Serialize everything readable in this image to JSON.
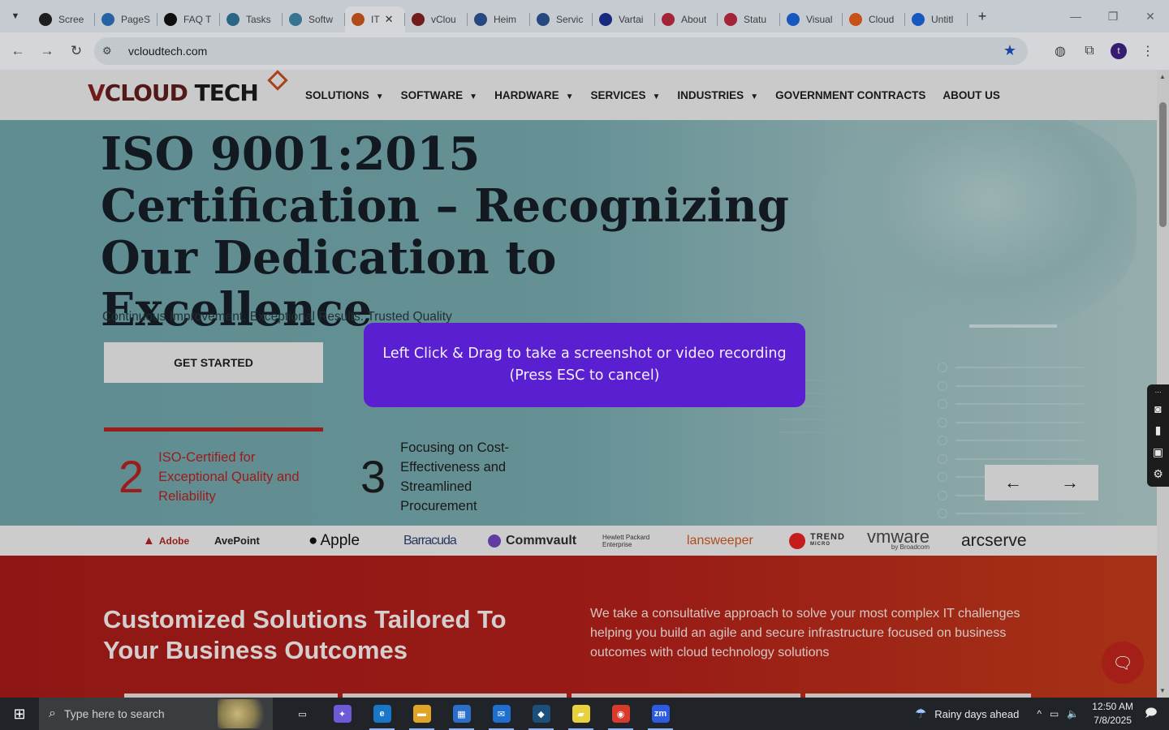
{
  "browser": {
    "tab_menu_icon": "chevron-down-icon",
    "tabs": [
      {
        "title": "Scree",
        "color": "#222222",
        "icon": "camera-icon"
      },
      {
        "title": "PageS",
        "color": "#2b6cb0",
        "icon": "gauge-icon"
      },
      {
        "title": "FAQ T",
        "color": "#111111",
        "icon": "openai-icon"
      },
      {
        "title": "Tasks",
        "color": "#2f6f8f",
        "icon": "hex-icon"
      },
      {
        "title": "Softw",
        "color": "#3b7f9a",
        "icon": "hex-icon"
      },
      {
        "title": "IT",
        "color": "#c0531d",
        "icon": "vcloud-icon",
        "active": true
      },
      {
        "title": "vClou",
        "color": "#7a1f1f",
        "icon": "v-icon"
      },
      {
        "title": "Heim",
        "color": "#2b4f8a",
        "icon": "scale-icon"
      },
      {
        "title": "Servic",
        "color": "#2b4f8a",
        "icon": "check-icon"
      },
      {
        "title": "Vartai",
        "color": "#1a2e8a",
        "icon": "x-icon"
      },
      {
        "title": "About",
        "color": "#b1283b",
        "icon": "dots-icon"
      },
      {
        "title": "Statu",
        "color": "#b1283b",
        "icon": "pin-icon"
      },
      {
        "title": "Visual",
        "color": "#1a5fd1",
        "icon": "pulse-icon"
      },
      {
        "title": "Cloud",
        "color": "#d85a1a",
        "icon": "slash-icon"
      },
      {
        "title": "Untitl",
        "color": "#1a5fd1",
        "icon": "doc-icon"
      }
    ],
    "new_tab": "+",
    "url": "vcloudtech.com"
  },
  "site": {
    "logo": {
      "v": "V",
      "rest": "CLOUD ",
      "tech": "TECH"
    },
    "menu": [
      {
        "label": "SOLUTIONS",
        "dropdown": true
      },
      {
        "label": "SOFTWARE",
        "dropdown": true
      },
      {
        "label": "HARDWARE",
        "dropdown": true
      },
      {
        "label": "SERVICES",
        "dropdown": true
      },
      {
        "label": "INDUSTRIES",
        "dropdown": true
      },
      {
        "label": "GOVERNMENT CONTRACTS",
        "dropdown": false
      },
      {
        "label": "ABOUT US",
        "dropdown": false
      }
    ],
    "hero": {
      "title_lines": [
        "ISO 9001:2015",
        "Certification – Recognizing",
        "Our Dedication to Excellence"
      ],
      "subtitle": "Continuous Improvement. Exceptional Results. Trusted Quality",
      "cta": "GET STARTED",
      "features": [
        {
          "num": "2",
          "lines": [
            "ISO-Certified for",
            "Exceptional Quality and",
            "Reliability"
          ]
        },
        {
          "num": "3",
          "lines": [
            "Focusing on Cost-",
            "Effectiveness and",
            "Streamlined",
            "Procurement"
          ]
        }
      ],
      "prev_arrow": "←",
      "next_arrow": "→"
    },
    "brands": {
      "adobe": "Adobe",
      "avepoint": "AvePoint",
      "apple": "Apple",
      "barracuda": "Barracuda",
      "commvault": "Commvault",
      "hpe_line1": "Hewlett Packard",
      "hpe_line2": "Enterprise",
      "lansweeper": "lansweeper",
      "trend": "TREND",
      "trend_sub": "MICRO",
      "vmware": "vmware",
      "vmware_sub": "by Broadcom",
      "arcserve": "arcserve"
    },
    "solutions": {
      "title_lines": [
        "Customized Solutions Tailored To",
        "Your Business Outcomes"
      ],
      "description": "We take a consultative approach to solve your most complex IT challenges helping you build an agile and secure infrastructure focused on business outcomes with cloud technology solutions"
    }
  },
  "capture_overlay": {
    "line1": "Left Click & Drag to take a screenshot or video recording",
    "line2": "(Press ESC to cancel)"
  },
  "taskbar": {
    "search_placeholder": "Type here to search",
    "weather": "Rainy days ahead",
    "time": "12:50 AM",
    "date": "7/8/2025",
    "apps": [
      {
        "name": "task-view",
        "color": "#202428",
        "glyph": "▭"
      },
      {
        "name": "copilot",
        "color": "#6b5bd6",
        "glyph": "✦"
      },
      {
        "name": "edge",
        "color": "#1877c9",
        "glyph": "e"
      },
      {
        "name": "file-explorer",
        "color": "#e0a526",
        "glyph": "▬"
      },
      {
        "name": "store",
        "color": "#2a6fc9",
        "glyph": "▦"
      },
      {
        "name": "mail",
        "color": "#1f6fd1",
        "glyph": "✉"
      },
      {
        "name": "app-hex",
        "color": "#1c4f7a",
        "glyph": "◆"
      },
      {
        "name": "sticky-notes",
        "color": "#e8d23a",
        "glyph": "▰"
      },
      {
        "name": "chrome",
        "color": "#d93a2b",
        "glyph": "◉"
      },
      {
        "name": "zoom",
        "color": "#2d5be3",
        "glyph": "zm"
      }
    ]
  }
}
